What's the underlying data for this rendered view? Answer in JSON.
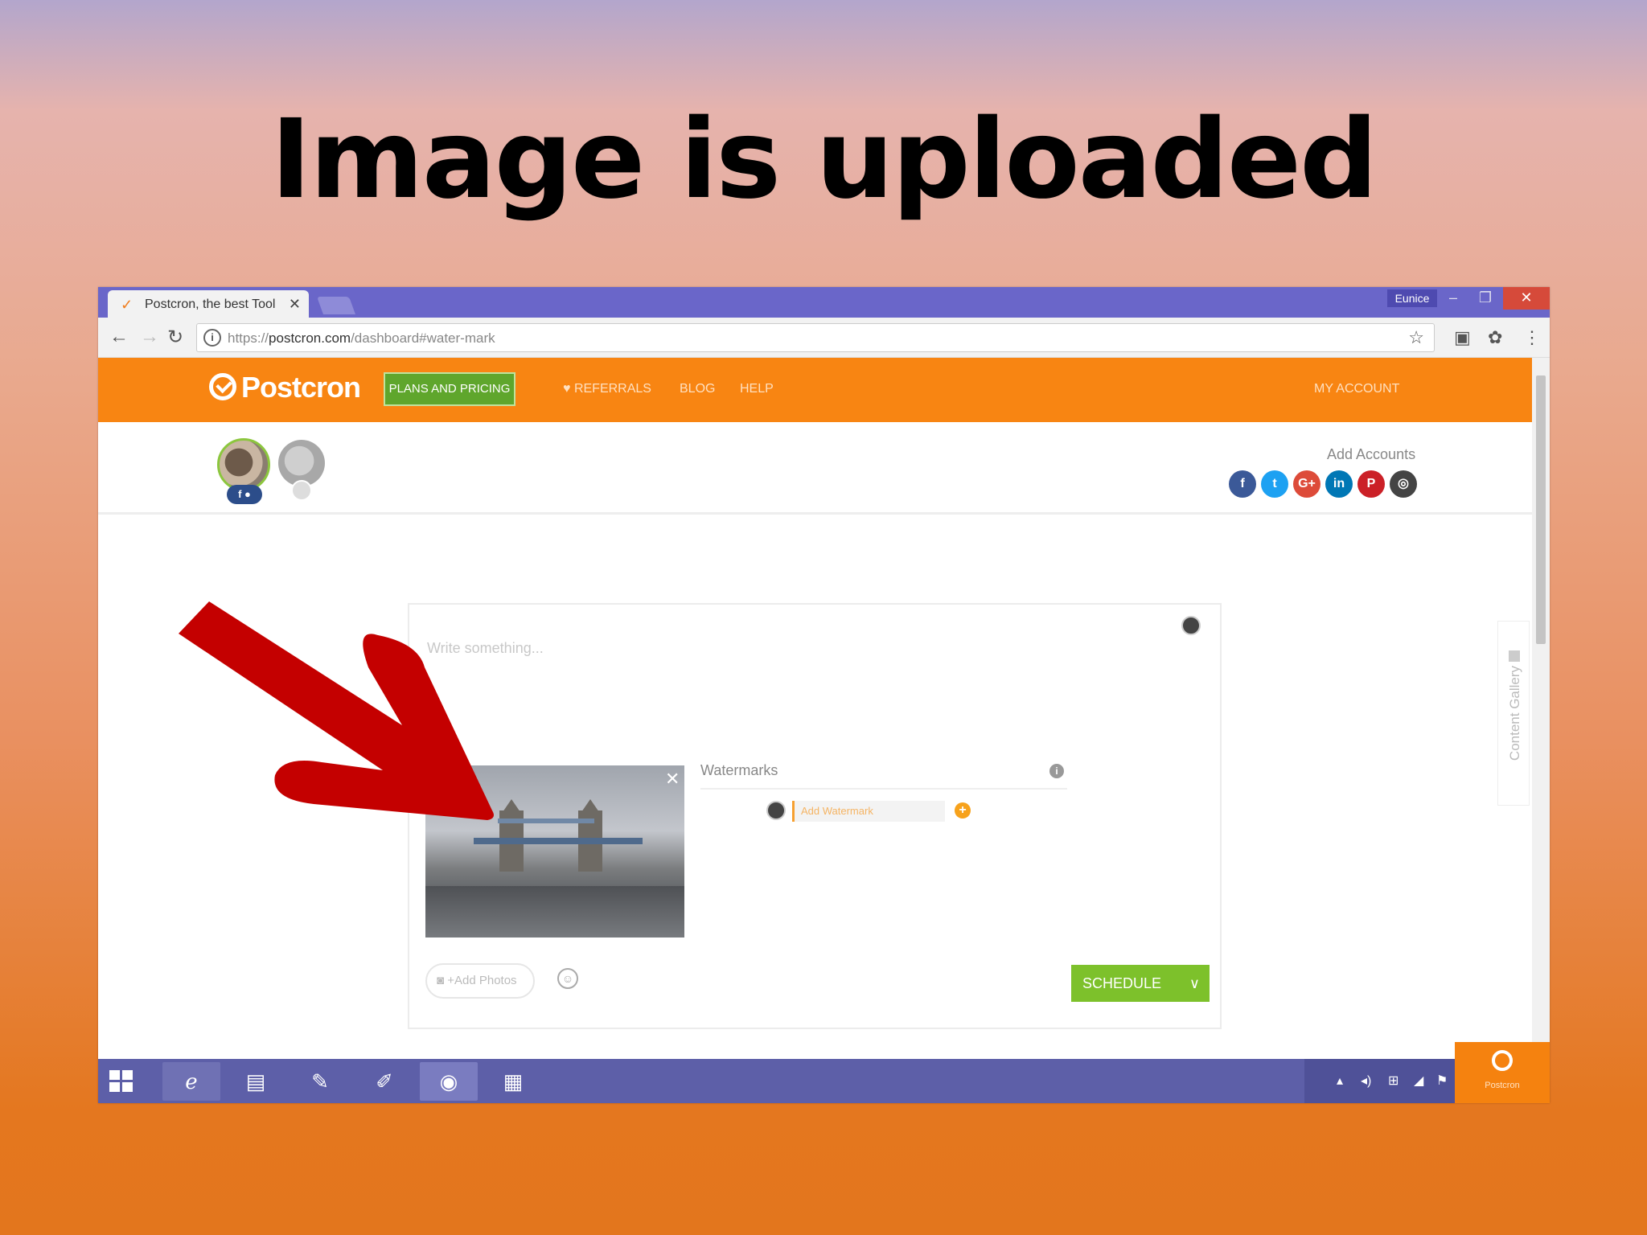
{
  "slide": {
    "title": "Image is uploaded"
  },
  "browser": {
    "tab_title": "Postcron, the best Tool",
    "user_badge": "Eunice",
    "url_scheme": "https://",
    "url_host": "postcron.com",
    "url_path": "/dashboard#water-mark"
  },
  "navbar": {
    "brand": "Postcron",
    "plans_label": "PLANS AND PRICING",
    "referrals_label": "REFERRALS",
    "blog_label": "BLOG",
    "help_label": "HELP",
    "account_label": "MY ACCOUNT"
  },
  "accounts": {
    "add_label": "Add Accounts",
    "networks": [
      "facebook",
      "twitter",
      "google-plus",
      "linkedin",
      "pinterest",
      "instagram"
    ],
    "network_glyphs": [
      "f",
      "t",
      "G+",
      "in",
      "P",
      "◎"
    ],
    "network_colors": [
      "#3b5998",
      "#1da1f2",
      "#dd4b39",
      "#0077b5",
      "#cb2027",
      "#444444"
    ]
  },
  "composer": {
    "placeholder": "Write something...",
    "watermarks_label": "Watermarks",
    "watermark_input": "Add Watermark",
    "add_photos_label": "+Add Photos",
    "schedule_label": "SCHEDULE"
  },
  "sidebar": {
    "content_gallery_label": "Content Gallery"
  },
  "badge": {
    "label": "Postcron"
  },
  "colors": {
    "navbar_orange": "#f88512",
    "schedule_green": "#7dc12b",
    "arrow_red": "#c40000"
  }
}
